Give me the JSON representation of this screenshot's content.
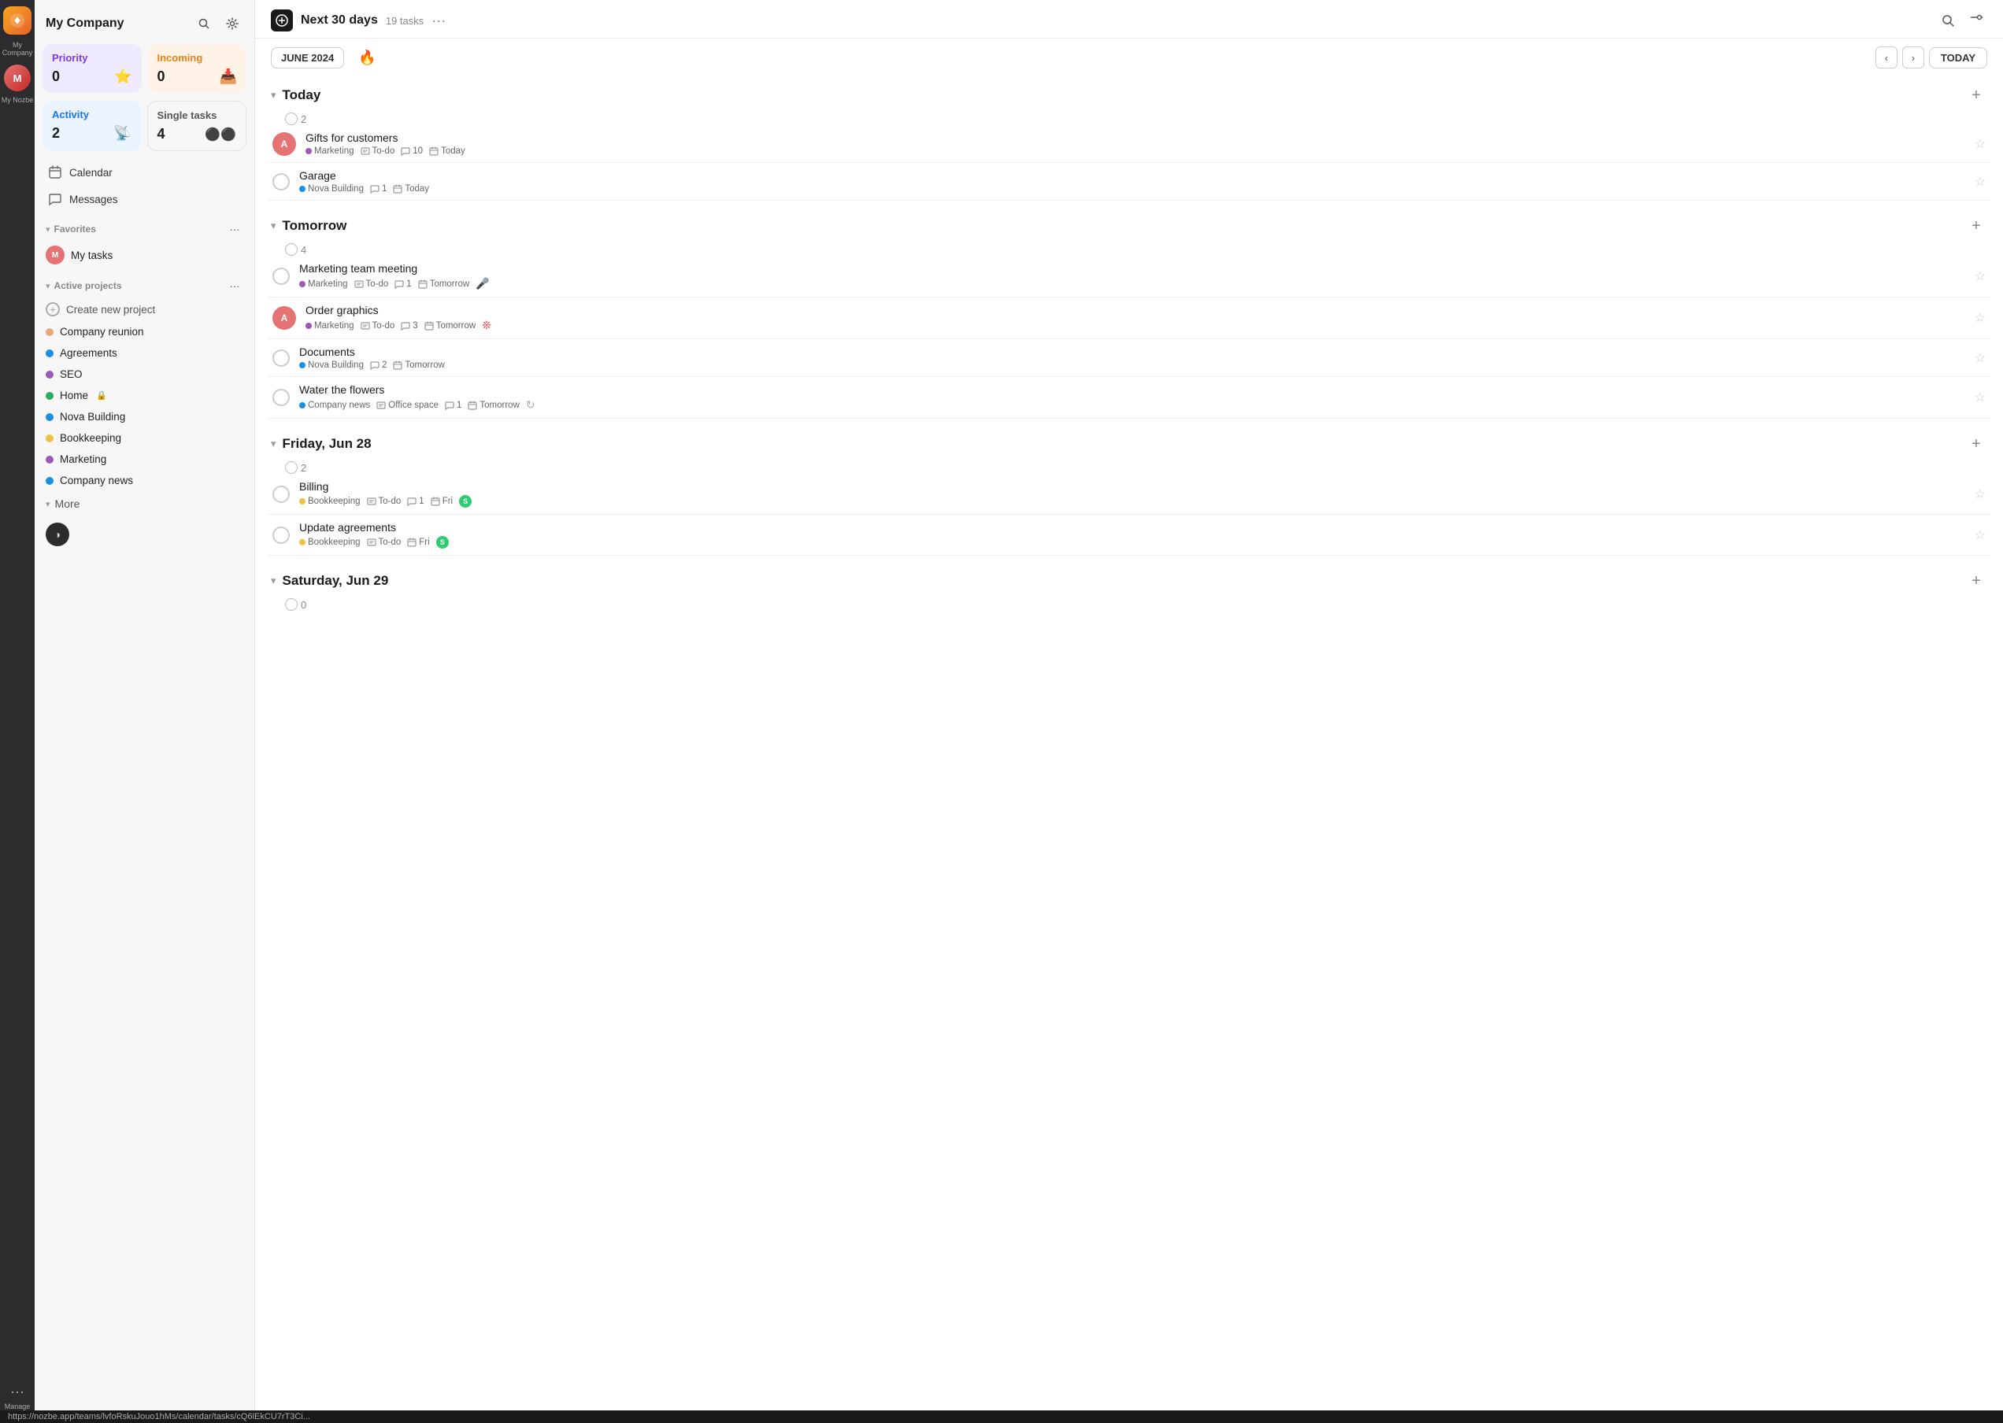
{
  "app": {
    "company": "My Company",
    "rail": {
      "manage_label": "Manage"
    }
  },
  "sidebar": {
    "title": "My Company",
    "cards": [
      {
        "id": "priority",
        "label": "Priority",
        "count": "0",
        "icon": "⭐"
      },
      {
        "id": "incoming",
        "label": "Incoming",
        "count": "0",
        "icon": "📥"
      },
      {
        "id": "activity",
        "label": "Activity",
        "count": "2",
        "icon": "📡"
      },
      {
        "id": "single",
        "label": "Single tasks",
        "count": "4",
        "icon": "⚫"
      }
    ],
    "nav_items": [
      {
        "id": "calendar",
        "label": "Calendar",
        "icon": "📅"
      },
      {
        "id": "messages",
        "label": "Messages",
        "icon": "💬"
      }
    ],
    "favorites": {
      "title": "Favorites",
      "items": [
        {
          "id": "my-tasks",
          "label": "My tasks",
          "avatar": "MT"
        }
      ]
    },
    "active_projects": {
      "title": "Active projects",
      "items": [
        {
          "id": "create",
          "label": "Create new project",
          "color": null
        },
        {
          "id": "company-reunion",
          "label": "Company reunion",
          "color": "#e8a87c"
        },
        {
          "id": "agreements",
          "label": "Agreements",
          "color": "#1a8fe3"
        },
        {
          "id": "seo",
          "label": "SEO",
          "color": "#9b59b6"
        },
        {
          "id": "home",
          "label": "Home",
          "color": "#27ae60",
          "lock": true
        },
        {
          "id": "nova-building",
          "label": "Nova Building",
          "color": "#1a8fe3"
        },
        {
          "id": "bookkeeping",
          "label": "Bookkeeping",
          "color": "#f0c040"
        },
        {
          "id": "marketing",
          "label": "Marketing",
          "color": "#9b59b6"
        },
        {
          "id": "company-news",
          "label": "Company news",
          "color": "#1a8fe3"
        }
      ]
    },
    "more_label": "More"
  },
  "topbar": {
    "title": "Next 30 days",
    "count": "19 tasks",
    "more": "···"
  },
  "calendar": {
    "month_label": "JUNE 2024",
    "prev": "<",
    "next": ">",
    "today_label": "TODAY"
  },
  "task_sections": [
    {
      "id": "today",
      "title": "Today",
      "count": "2",
      "tasks": [
        {
          "id": "t1",
          "name": "Gifts for customers",
          "project": "Marketing",
          "project_color": "#9b59b6",
          "section": "To-do",
          "comments": "10",
          "date": "Today",
          "avatar_bg": "#e57373",
          "avatar_text": "A",
          "has_avatar": true,
          "star": false
        },
        {
          "id": "t2",
          "name": "Garage",
          "project": "Nova Building",
          "project_color": "#1a8fe3",
          "section": null,
          "comments": "1",
          "date": "Today",
          "has_avatar": false,
          "star": false
        }
      ]
    },
    {
      "id": "tomorrow",
      "title": "Tomorrow",
      "count": "4",
      "tasks": [
        {
          "id": "t3",
          "name": "Marketing team meeting",
          "project": "Marketing",
          "project_color": "#9b59b6",
          "section": "To-do",
          "comments": "1",
          "date": "Tomorrow",
          "has_avatar": false,
          "extra_icon": "🎤",
          "star": false
        },
        {
          "id": "t4",
          "name": "Order graphics",
          "project": "Marketing",
          "project_color": "#9b59b6",
          "section": "To-do",
          "comments": "3",
          "date": "Tomorrow",
          "avatar_bg": "#e57373",
          "avatar_text": "A",
          "has_avatar": true,
          "extra_icon": "❊",
          "star": false
        },
        {
          "id": "t5",
          "name": "Documents",
          "project": "Nova Building",
          "project_color": "#1a8fe3",
          "section": null,
          "comments": "2",
          "date": "Tomorrow",
          "has_avatar": false,
          "star": false
        },
        {
          "id": "t6",
          "name": "Water the flowers",
          "project": "Company news",
          "project_color": "#1a8fe3",
          "section": "Office space",
          "comments": "1",
          "date": "Tomorrow",
          "has_avatar": false,
          "extra_icon": "↻",
          "star": false
        }
      ]
    },
    {
      "id": "friday-jun-28",
      "title": "Friday, Jun 28",
      "count": "2",
      "tasks": [
        {
          "id": "t7",
          "name": "Billing",
          "project": "Bookkeeping",
          "project_color": "#f0c040",
          "section": "To-do",
          "comments": "1",
          "date": "Fri",
          "has_avatar": false,
          "extra_icon": "S",
          "extra_icon_style": "dollar",
          "star": false
        },
        {
          "id": "t8",
          "name": "Update agreements",
          "project": "Bookkeeping",
          "project_color": "#f0c040",
          "section": "To-do",
          "comments": null,
          "date": "Fri",
          "has_avatar": false,
          "extra_icon": "S",
          "extra_icon_style": "dollar",
          "star": false
        }
      ]
    },
    {
      "id": "saturday-jun-29",
      "title": "Saturday, Jun 29",
      "count": "0",
      "tasks": []
    }
  ],
  "status_bar": {
    "url": "https://nozbe.app/teams/lvfoRskuJouo1hMs/calendar/tasks/cQ6lEkCU7rT3Ci..."
  }
}
